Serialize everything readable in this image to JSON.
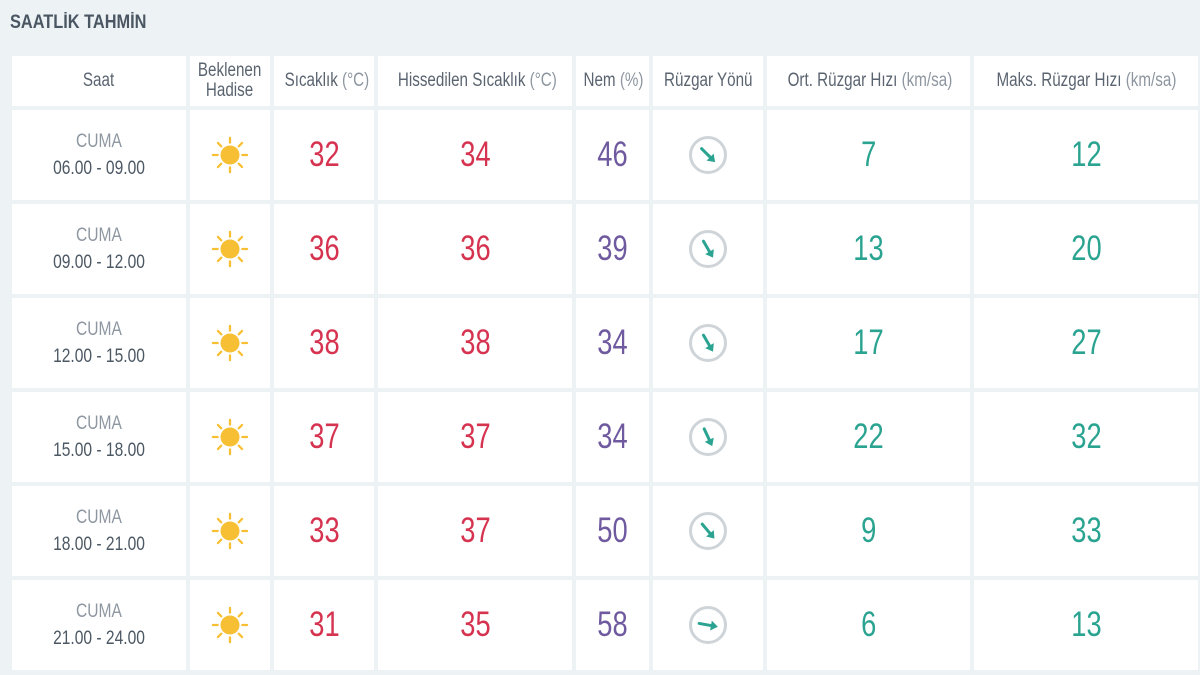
{
  "page": {
    "title": "SAATLİK TAHMİN"
  },
  "columns": {
    "saat": "Saat",
    "hadise_line1": "Beklenen",
    "hadise_line2": "Hadise",
    "sicaklik": "Sıcaklık",
    "sicaklik_unit": "(°C)",
    "hissedilen": "Hissedilen Sıcaklık",
    "hissedilen_unit": "(°C)",
    "nem": "Nem",
    "nem_unit": "(%)",
    "ruzgar_yonu": "Rüzgar Yönü",
    "ort_ruzgar": "Ort. Rüzgar Hızı",
    "ort_ruzgar_unit": "(km/sa)",
    "maks_ruzgar": "Maks. Rüzgar Hızı",
    "maks_ruzgar_unit": "(km/sa)"
  },
  "rows": [
    {
      "day": "CUMA",
      "time": "06.00 - 09.00",
      "weather_icon": "sun-icon",
      "temp": "32",
      "feels": "34",
      "humidity": "46",
      "wind_dir_deg": 135,
      "wind_avg": "7",
      "wind_max": "12"
    },
    {
      "day": "CUMA",
      "time": "09.00 - 12.00",
      "weather_icon": "sun-icon",
      "temp": "36",
      "feels": "36",
      "humidity": "39",
      "wind_dir_deg": 150,
      "wind_avg": "13",
      "wind_max": "20"
    },
    {
      "day": "CUMA",
      "time": "12.00 - 15.00",
      "weather_icon": "sun-icon",
      "temp": "38",
      "feels": "38",
      "humidity": "34",
      "wind_dir_deg": 150,
      "wind_avg": "17",
      "wind_max": "27"
    },
    {
      "day": "CUMA",
      "time": "15.00 - 18.00",
      "weather_icon": "sun-icon",
      "temp": "37",
      "feels": "37",
      "humidity": "34",
      "wind_dir_deg": 155,
      "wind_avg": "22",
      "wind_max": "32"
    },
    {
      "day": "CUMA",
      "time": "18.00 - 21.00",
      "weather_icon": "sun-icon",
      "temp": "33",
      "feels": "37",
      "humidity": "50",
      "wind_dir_deg": 140,
      "wind_avg": "9",
      "wind_max": "33"
    },
    {
      "day": "CUMA",
      "time": "21.00 - 24.00",
      "weather_icon": "sun-icon",
      "temp": "31",
      "feels": "35",
      "humidity": "58",
      "wind_dir_deg": 100,
      "wind_avg": "6",
      "wind_max": "13"
    }
  ],
  "colors": {
    "temperature": "#d5334f",
    "humidity": "#6f5aa0",
    "wind": "#2aa391",
    "sun": "#f7c034"
  }
}
